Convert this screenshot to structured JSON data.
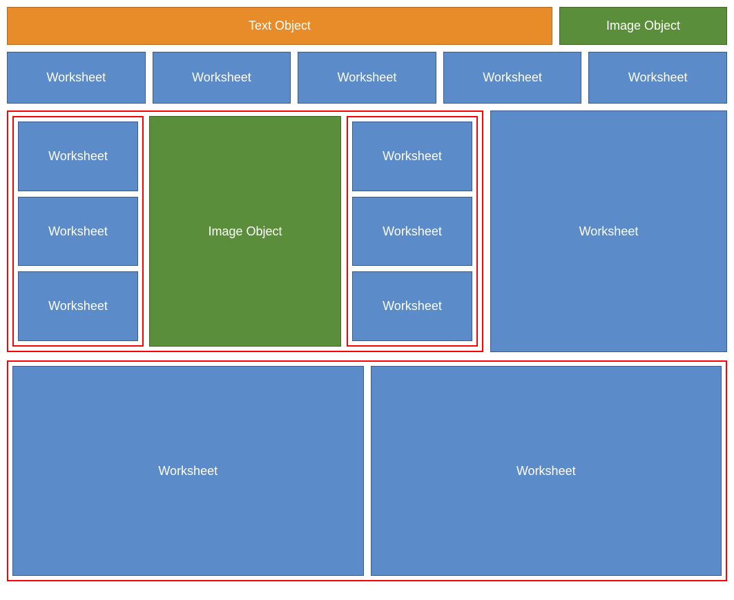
{
  "header": {
    "text_object": "Text Object",
    "image_object": "Image Object"
  },
  "nav": {
    "items": [
      "Worksheet",
      "Worksheet",
      "Worksheet",
      "Worksheet",
      "Worksheet"
    ]
  },
  "content": {
    "left_stack": [
      "Worksheet",
      "Worksheet",
      "Worksheet"
    ],
    "image_center": "Image Object",
    "right_stack": [
      "Worksheet",
      "Worksheet",
      "Worksheet"
    ],
    "big_worksheet": "Worksheet"
  },
  "bottom": {
    "left": "Worksheet",
    "right": "Worksheet"
  },
  "colors": {
    "blue": "#5b8bc9",
    "orange": "#e88c29",
    "green": "#5a8e3a",
    "red_outline": "#ff0000"
  }
}
